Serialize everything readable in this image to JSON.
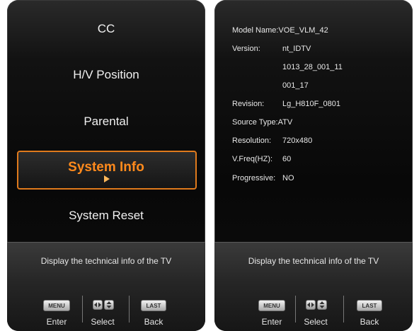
{
  "left_panel": {
    "menu": {
      "items": [
        "CC",
        "H/V Position",
        "Parental",
        "System Info",
        "System Reset"
      ],
      "selected_index": 3
    },
    "description": "Display the technical info of the TV",
    "buttons": {
      "menu_key": "MENU",
      "enter_label": "Enter",
      "select_label": "Select",
      "last_key": "LAST",
      "back_label": "Back"
    }
  },
  "right_panel": {
    "info": {
      "model_name_label": "Model Name:",
      "model_name_value": "VOE_VLM_42",
      "version_label": "Version:",
      "version_line1": "nt_IDTV",
      "version_line2": "1013_28_001_11",
      "version_line3": "001_17",
      "revision_label": "Revision:",
      "revision_value": "Lg_H810F_0801",
      "source_type_label": "Source Type:",
      "source_type_value": "ATV",
      "resolution_label": "Resolution:",
      "resolution_value": "720x480",
      "vfreq_label": "V.Freq(HZ):",
      "vfreq_value": "60",
      "progressive_label": "Progressive:",
      "progressive_value": "NO"
    },
    "description": "Display the technical info of the TV",
    "buttons": {
      "menu_key": "MENU",
      "enter_label": "Enter",
      "select_label": "Select",
      "last_key": "LAST",
      "back_label": "Back"
    }
  },
  "colors": {
    "accent": "#ff8a1c",
    "panel_bg": "#0a0a0a"
  }
}
